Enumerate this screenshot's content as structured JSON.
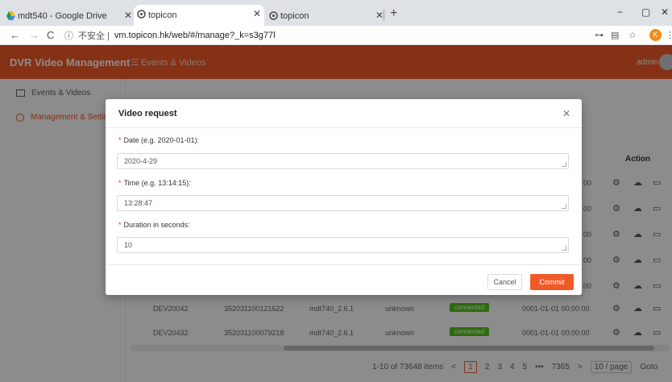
{
  "browser": {
    "tabs": [
      {
        "title": "mdt540 - Google Drive",
        "active": false
      },
      {
        "title": "topicon",
        "active": true
      },
      {
        "title": "topicon",
        "active": false
      }
    ],
    "new_tab": "+",
    "url_prefix": "不安全 |",
    "url": "vm.topicon.hk/web/#/manage?_k=s3g77l",
    "profile_initial": "K",
    "minimize": "−",
    "restore": "▢",
    "close": "✕"
  },
  "app": {
    "title": "DVR Video Management",
    "header_menu": "Events & Videos",
    "user": "admin",
    "sidebar": [
      {
        "label": "Events & Videos",
        "active": false
      },
      {
        "label": "Management & Settings",
        "active": true
      }
    ],
    "table": {
      "action_header": "Action",
      "row_times": [
        "00",
        "00",
        "00",
        "00",
        "00"
      ],
      "rows": [
        {
          "device": "DEV20042",
          "id": "352031100121622",
          "model": "mdt740_2.6.1",
          "status": "unknown",
          "state": "connected",
          "time": "0001-01-01 00:00:00"
        },
        {
          "device": "DEV20432",
          "id": "352031100079218",
          "model": "mdt740_2.6.1",
          "status": "unknown",
          "state": "connected",
          "time": "0001-01-01 00:00:00"
        }
      ]
    },
    "pagination": {
      "summary": "1-10 of 73648 items",
      "prev": "<",
      "pages": [
        "1",
        "2",
        "3",
        "4",
        "5"
      ],
      "ellipsis": "•••",
      "last": "7365",
      "next": ">",
      "page_size": "10 / page",
      "goto": "Goto"
    }
  },
  "modal": {
    "title": "Video request",
    "close": "✕",
    "fields": [
      {
        "label": "Date (e.g. 2020-01-01):",
        "value": "2020-4-29"
      },
      {
        "label": "Time (e.g. 13:14:15):",
        "value": "13:28:47"
      },
      {
        "label": "Duration in seconds:",
        "value": "10"
      }
    ],
    "required_mark": "*",
    "cancel_label": "Cancel",
    "commit_label": "Commit"
  }
}
